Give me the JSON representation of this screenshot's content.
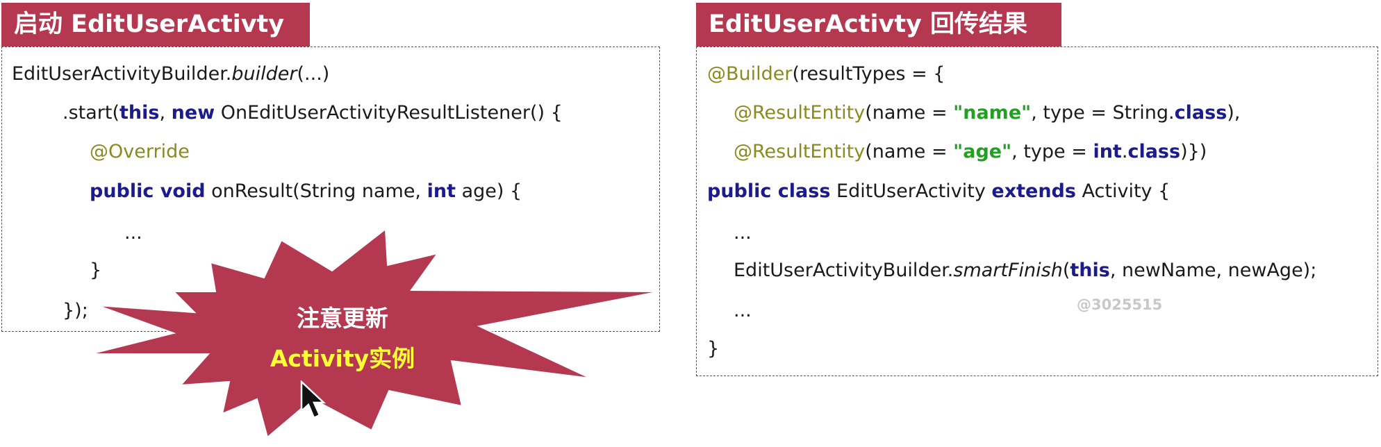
{
  "left": {
    "title": "启动 EditUserActivty",
    "lines": {
      "l1a": "EditUserActivityBuilder.",
      "l1b": "builder",
      "l1c": "(...)",
      "l2a": ".start(",
      "l2b": "this",
      "l2c": ", ",
      "l2d": "new",
      "l2e": " OnEditUserActivityResultListener() {",
      "l3": "@Override",
      "l4a": "public void",
      "l4b": " onResult(String name, ",
      "l4c": "int",
      "l4d": " age) {",
      "l5": "...",
      "l6": "}",
      "l7": "});"
    }
  },
  "right": {
    "title": "EditUserActivty 回传结果",
    "lines": {
      "r1a": "@Builder",
      "r1b": "(resultTypes = {",
      "r2a": "@ResultEntity",
      "r2b": "(name = ",
      "r2c": "\"name\"",
      "r2d": ", type = String.",
      "r2e": "class",
      "r2f": "),",
      "r3a": "@ResultEntity",
      "r3b": "(name = ",
      "r3c": "\"age\"",
      "r3d": ", type = ",
      "r3e": "int",
      "r3f": ".",
      "r3g": "class",
      "r3h": ")})",
      "r4a": "public class",
      "r4b": " EditUserActivity ",
      "r4c": "extends",
      "r4d": " Activity {",
      "r5": "...",
      "r6a": "EditUserActivityBuilder.",
      "r6b": "smartFinish",
      "r6c": "(",
      "r6d": "this",
      "r6e": ", newName, newAge);",
      "r7": "...",
      "r8": "}"
    }
  },
  "callout": {
    "line1": "注意更新",
    "line2": "Activity实例",
    "fill": "#b4384f",
    "line1_color": "#ffffff",
    "line2_color": "#ffff33"
  },
  "watermark": "@3025515",
  "colors": {
    "title_bg": "#b4384f",
    "keyword": "#1b1b8c",
    "annotation": "#8a8a1e",
    "string": "#22a022"
  },
  "icons": {
    "cursor": "mouse-pointer-icon"
  }
}
